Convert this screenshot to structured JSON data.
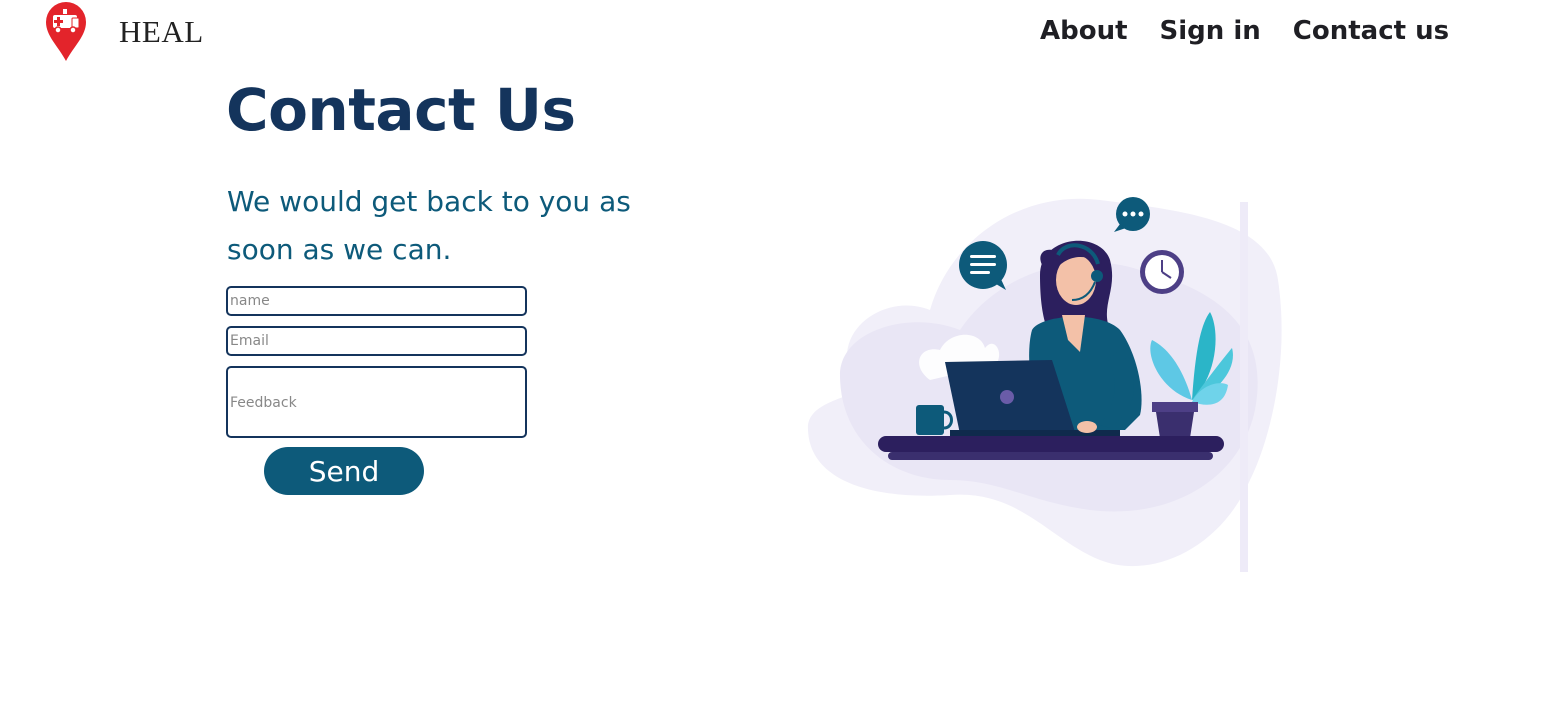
{
  "header": {
    "brand": "HEAL",
    "nav": [
      {
        "label": "About"
      },
      {
        "label": "Sign in"
      },
      {
        "label": "Contact us"
      }
    ]
  },
  "main": {
    "title": "Contact Us",
    "subtitle": "We would get back to you as soon as we can.",
    "form": {
      "name_placeholder": "name",
      "email_placeholder": "Email",
      "feedback_placeholder": "Feedback",
      "send_label": "Send"
    }
  },
  "colors": {
    "primary_dark": "#14345c",
    "accent_teal": "#0d5a7a",
    "logo_red": "#e3242b"
  },
  "icons": [
    "ambulance-location-pin-icon",
    "customer-support-illustration"
  ]
}
